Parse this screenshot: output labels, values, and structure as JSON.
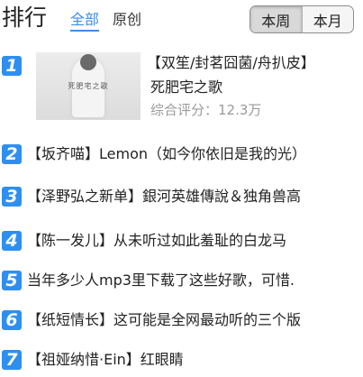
{
  "header": {
    "title": "排行",
    "tabs": [
      {
        "label": "全部",
        "active": true
      },
      {
        "label": "原创",
        "active": false
      }
    ],
    "period_toggle": [
      {
        "label": "本周",
        "active": true
      },
      {
        "label": "本月",
        "active": false
      }
    ]
  },
  "colors": {
    "accent": "#3a8ee6",
    "rank_badge": "#2f8ff0",
    "score_text": "#9a9a9a"
  },
  "top_item": {
    "rank": "1",
    "tag": "【双笙/封茗囧菌/舟扒皮】",
    "name": "死肥宅之歌",
    "score": "综合评分：12.3万",
    "cover_text": "死肥宅之歌"
  },
  "list": [
    {
      "rank": "2",
      "text": "【坂齐喵】Lemon（如今你依旧是我的光）"
    },
    {
      "rank": "3",
      "text": "【泽野弘之新单】銀河英雄傳說＆独角兽高"
    },
    {
      "rank": "4",
      "text": "【陈一发儿】从未听过如此羞耻的白龙马"
    },
    {
      "rank": "5",
      "text": "当年多少人mp3里下载了这些好歌，可惜."
    },
    {
      "rank": "6",
      "text": "【纸短情长】这可能是全网最动听的三个版"
    },
    {
      "rank": "7",
      "text": "【祖娅纳惜·Ein】红眼睛"
    }
  ]
}
